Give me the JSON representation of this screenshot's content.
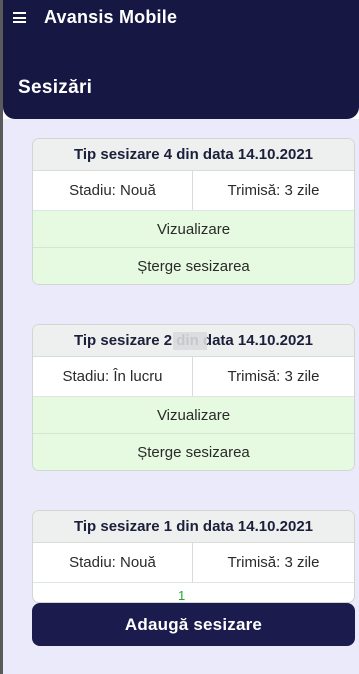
{
  "app": {
    "title": "Avansis Mobile"
  },
  "header": {
    "title": "Sesizări"
  },
  "cards": [
    {
      "title": "Tip sesizare 4 din data 14.10.2021",
      "status": "Stadiu: Nouă",
      "sent": "Trimisă: 3 zile",
      "view_label": "Vizualizare",
      "delete_label": "Șterge sesizarea"
    },
    {
      "title": "Tip sesizare 2 din data 14.10.2021",
      "status": "Stadiu: În lucru",
      "sent": "Trimisă: 3 zile",
      "view_label": "Vizualizare",
      "delete_label": "Șterge sesizarea"
    },
    {
      "title": "Tip sesizare 1 din data 14.10.2021",
      "status": "Stadiu: Nouă",
      "sent": "Trimisă: 3 zile"
    }
  ],
  "footer": {
    "page_number": "1",
    "add_label": "Adaugă sesizare"
  },
  "colors": {
    "primary": "#171744",
    "content_background": "#ebeafa",
    "action_background": "#e6f9e1",
    "indicator": "#1ea82b"
  },
  "icons": {
    "menu": "hamburger-icon"
  }
}
